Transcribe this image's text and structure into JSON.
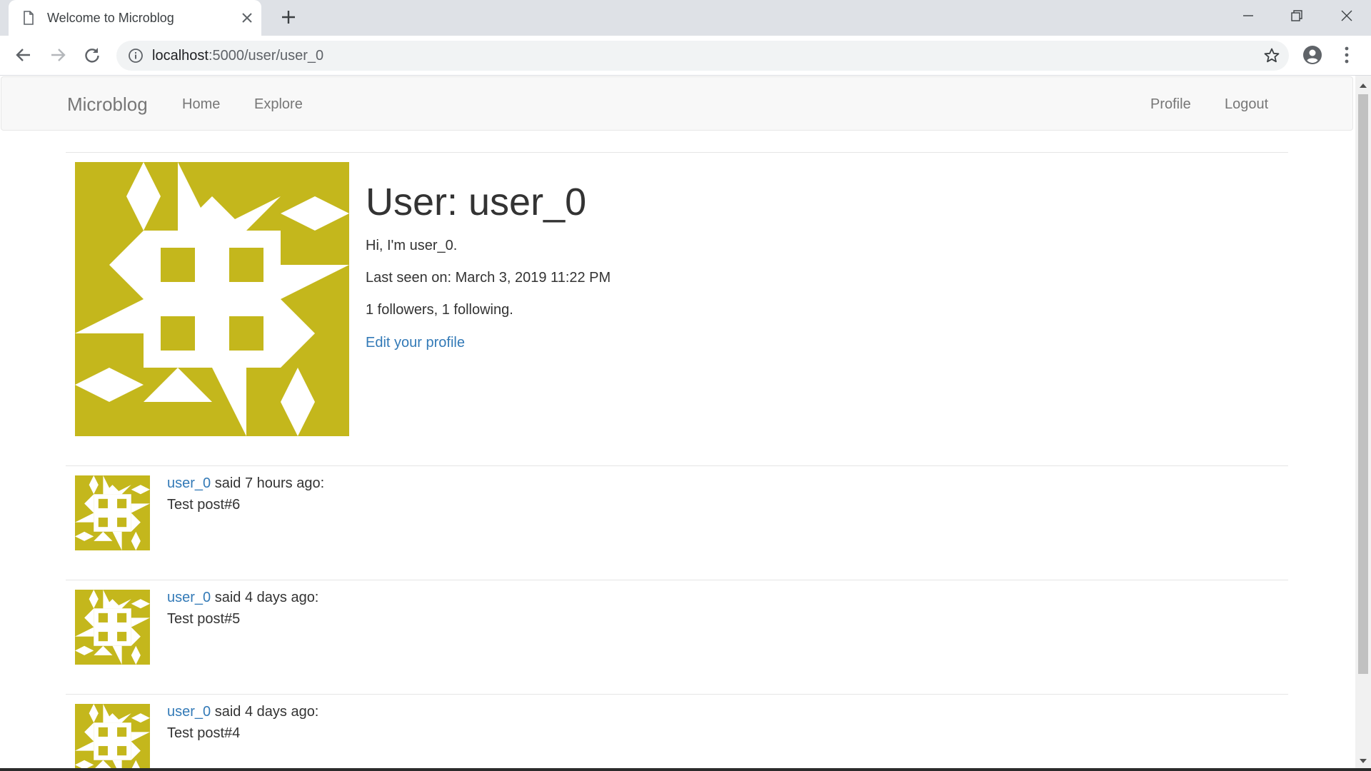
{
  "browser": {
    "tab_title": "Welcome to Microblog",
    "url_host": "localhost",
    "url_rest": ":5000/user/user_0"
  },
  "navbar": {
    "brand": "Microblog",
    "left_links": [
      "Home",
      "Explore"
    ],
    "right_links": [
      "Profile",
      "Logout"
    ]
  },
  "profile": {
    "heading": "User: user_0",
    "about_me": "Hi, I'm user_0.",
    "last_seen": "Last seen on: March 3, 2019 11:22 PM",
    "follow_stats": "1 followers, 1 following.",
    "edit_link": "Edit your profile",
    "avatar_color": "#c4b71c"
  },
  "posts": [
    {
      "author": "user_0",
      "meta": " said 7 hours ago:",
      "body": "Test post#6"
    },
    {
      "author": "user_0",
      "meta": " said 4 days ago:",
      "body": "Test post#5"
    },
    {
      "author": "user_0",
      "meta": " said 4 days ago:",
      "body": "Test post#4"
    }
  ],
  "icons": {
    "tab": "document-icon",
    "close": "close-icon",
    "new_tab": "plus-icon",
    "back": "arrow-back-icon",
    "forward": "arrow-forward-icon",
    "reload": "reload-icon",
    "site_info": "info-icon",
    "bookmark": "star-icon",
    "account": "account-circle-icon",
    "menu": "kebab-menu-icon"
  }
}
